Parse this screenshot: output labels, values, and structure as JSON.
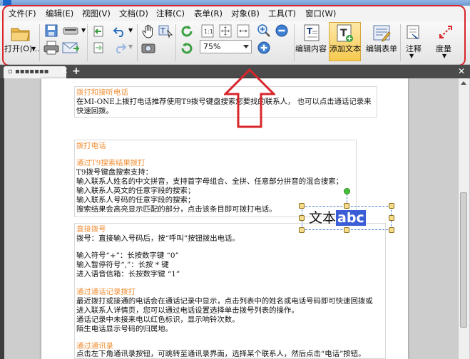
{
  "menu": [
    "文件(F)",
    "编辑(E)",
    "视图(V)",
    "文档(D)",
    "注释(C)",
    "表单(R)",
    "对象(B)",
    "工具(T)",
    "窗口(W)"
  ],
  "toolbar": {
    "open_label": "打开(O)...",
    "zoom_value": "75%",
    "edit_content_label": "编辑内容",
    "add_text_label": "添加文本",
    "edit_form_label": "编辑表单",
    "annotate_label": "注释",
    "measure_label": "度量"
  },
  "annotation": {
    "text": "文本",
    "selected": "abc"
  },
  "document": {
    "block1": [
      "拨打和接听电话",
      "在MI-ONE上拨打电话推荐使用T9拨号键盘搜索您要找的联系人， 也可以点击通话记录来",
      "快速回拨。"
    ],
    "block2": [
      "拨打电话",
      "",
      "通过T9搜索结果拨打",
      "T9拨号键盘搜索支持：",
      "输入联系人姓名的中文拼音，支持首字母组合、全拼、任意部分拼音的混合搜索；",
      "输入联系人英文的任意字段的搜索；",
      "输入联系人号码的任意字段的搜索；",
      "搜索结果会高亮显示匹配的部分，点击该条目即可拨打电话。"
    ],
    "block3": [
      "直接拨号",
      "拨号：直接输入号码后，按“呼叫”按钮拨出电话。",
      "",
      "输入符号“+”：长按数字键 “0”",
      "输入暂停符号“,”：长按 * 键",
      "进入语音信箱：长按数字键 “1”",
      "",
      "通过通话记录拨打",
      "最近拨打或接通的电话会在通话记录中显示，点击列表中的姓名或电话号码即可快速回拨或",
      "进入联系人详情页，您可以通过电话设置选择单击拨号列表的操作。",
      "通话记录中未接来电以红色标识，显示响铃次数。",
      "陌生电话显示号码的归属地。",
      "",
      "通过通讯录",
      "点击左下角通讯录按钮，可跳转至通讯录界面，选择某个联系人，然后点击“电话”按钮。"
    ]
  },
  "colors": {
    "highlight": "#d8262b",
    "accent_orange": "#f0913a",
    "selection": "#3b5ed6"
  }
}
